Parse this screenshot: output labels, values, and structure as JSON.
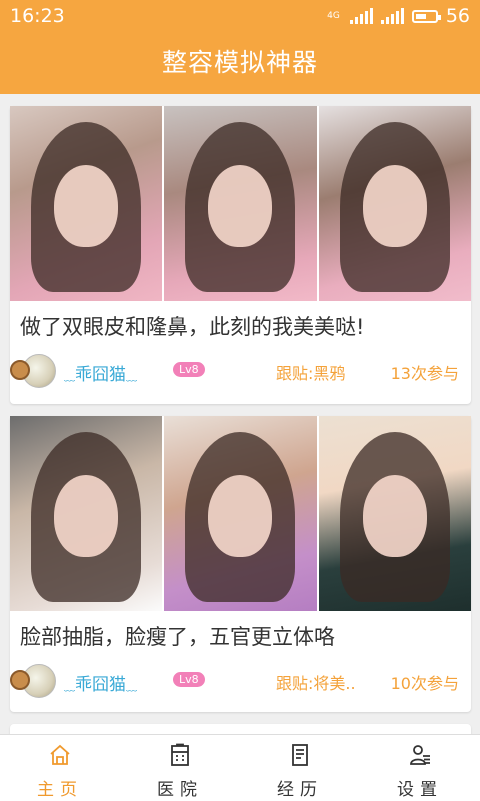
{
  "status_bar": {
    "time": "16:23",
    "network": "4G",
    "battery": "56",
    "battery_level": 0.56
  },
  "header": {
    "title": "整容模拟神器"
  },
  "posts": [
    {
      "caption": "做了双眼皮和隆鼻，此刻的我美美哒!",
      "username": "乖囧猫",
      "level": "Lv8",
      "tie": "跟贴:黑鸦",
      "count": "13次参与"
    },
    {
      "caption": "脸部抽脂，脸瘦了，五官更立体咯",
      "username": "乖囧猫",
      "level": "Lv8",
      "tie": "跟贴:将美..",
      "count": "10次参与"
    }
  ],
  "tabs": [
    {
      "label": "主页",
      "icon": "home-icon",
      "active": true
    },
    {
      "label": "医院",
      "icon": "hospital-icon",
      "active": false
    },
    {
      "label": "经历",
      "icon": "document-icon",
      "active": false
    },
    {
      "label": "设置",
      "icon": "user-settings-icon",
      "active": false
    }
  ],
  "colors": {
    "accent": "#f6a640",
    "active_tab": "#f09a2e",
    "username": "#39a9d6",
    "level_badge": "#f280b8"
  }
}
